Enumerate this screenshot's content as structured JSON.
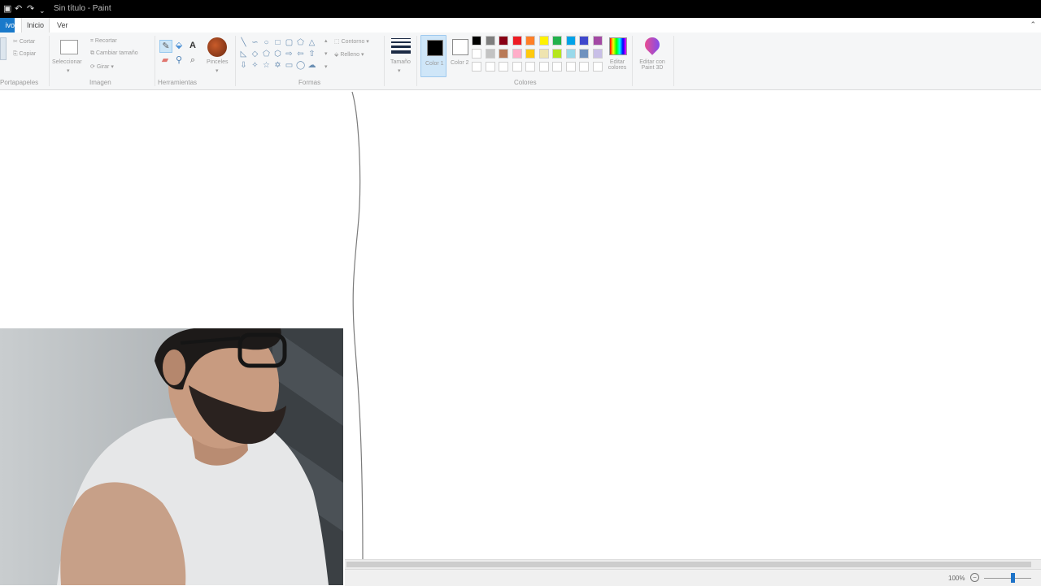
{
  "window": {
    "title": "Sin título - Paint",
    "quick_access": [
      "▣",
      "↶",
      "↷",
      "⌄"
    ]
  },
  "tabs": {
    "file": "ivo",
    "home": "Inicio",
    "view": "Ver",
    "collapse_icon": "chevron-up-icon"
  },
  "ribbon": {
    "clipboard": {
      "label": "Portapapeles",
      "cut": "Cortar",
      "copy": "Copiar"
    },
    "image": {
      "label": "Imagen",
      "select": "Seleccionar",
      "crop": "Recortar",
      "resize": "Cambiar tamaño",
      "rotate": "Girar"
    },
    "tools": {
      "label": "Herramientas",
      "brushes": "Pinceles"
    },
    "shapes": {
      "label": "Formas",
      "outline": "Contorno",
      "fill": "Relleno"
    },
    "size": {
      "label": "Tamaño"
    },
    "colors": {
      "label": "Colores",
      "color1": "Color 1",
      "color2": "Color 2",
      "color1_value": "#000000",
      "color2_value": "#ffffff",
      "palette_row1": [
        "#000000",
        "#7f7f7f",
        "#880015",
        "#ed1c24",
        "#ff7f27",
        "#fff200",
        "#22b14c",
        "#00a2e8",
        "#3f48cc",
        "#a349a4"
      ],
      "palette_row2": [
        "#ffffff",
        "#c3c3c3",
        "#b97a57",
        "#ffaec9",
        "#ffc90e",
        "#efe4b0",
        "#b5e61d",
        "#99d9ea",
        "#7092be",
        "#c8bfe7"
      ],
      "palette_row3": [
        "#ffffff",
        "#ffffff",
        "#ffffff",
        "#ffffff",
        "#ffffff",
        "#ffffff",
        "#ffffff",
        "#ffffff",
        "#ffffff",
        "#ffffff"
      ],
      "edit_colors": "Editar colores",
      "paint3d": "Editar con Paint 3D"
    }
  },
  "statusbar": {
    "zoom": "100%"
  }
}
